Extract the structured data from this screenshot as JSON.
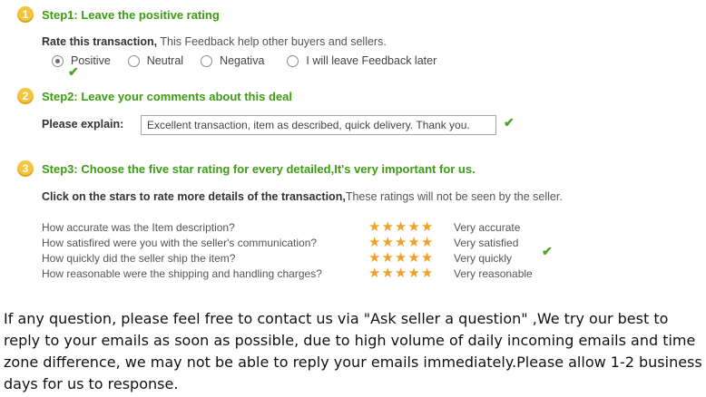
{
  "step1": {
    "num": "1",
    "title": "Step1: Leave the positive rating",
    "rate_bold": "Rate this transaction,",
    "rate_text": " This Feedback help other buyers and sellers.",
    "options": [
      "Positive",
      "Neutral",
      "Negativa",
      "I will leave Feedback later"
    ],
    "selected": "Positive"
  },
  "step2": {
    "num": "2",
    "title": "Step2: Leave your comments about this deal",
    "label": "Please explain:",
    "comment": "Excellent transaction, item as described, quick delivery. Thank you."
  },
  "step3": {
    "num": "3",
    "title": "Step3: Choose the five star rating for every detailed,It's very important for us.",
    "click_bold": "Click on the stars to rate more details of the transaction,",
    "click_text": "These ratings will not be seen by the seller.",
    "ratings": [
      {
        "question": "How accurate was the Item description?",
        "stars": 5,
        "value": "Very accurate"
      },
      {
        "question": "How satisfired were you with the seller's communication?",
        "stars": 5,
        "value": "Very satisfied"
      },
      {
        "question": "How quickly did the seller ship the item?",
        "stars": 5,
        "value": "Very quickly"
      },
      {
        "question": "How reasonable were the shipping and handling charges?",
        "stars": 5,
        "value": "Very reasonable"
      }
    ]
  },
  "footer": {
    "text": "If any question, please feel free to contact us via \"Ask seller a question\" ,We try our best to reply to your emails as soon as possible, due to high volume of daily incoming emails and time zone difference, we may not be able to reply your emails immediately.Please allow 1-2 business days for us to response."
  },
  "colors": {
    "step_title": "#3c9d12",
    "badge": "#f2c53d",
    "star": "#f0a12a",
    "check": "#4aa520"
  },
  "icons": {
    "check": "check-icon",
    "star": "star-icon"
  }
}
